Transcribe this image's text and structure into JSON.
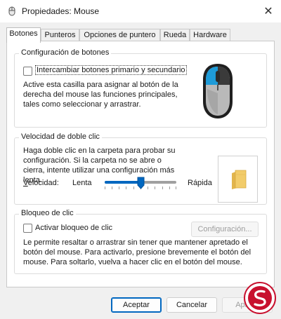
{
  "window": {
    "title": "Propiedades: Mouse",
    "close_glyph": "✕"
  },
  "tabs": [
    {
      "label": "Botones",
      "active": true
    },
    {
      "label": "Punteros",
      "active": false
    },
    {
      "label": "Opciones de puntero",
      "active": false
    },
    {
      "label": "Rueda",
      "active": false
    },
    {
      "label": "Hardware",
      "active": false
    }
  ],
  "button_config": {
    "title": "Configuración de botones",
    "swap_checkbox": {
      "label": "Intercambiar botones primario y secundario",
      "checked": false
    },
    "description": "Active esta casilla para asignar al botón de la derecha del mouse las funciones principales, tales como seleccionar y arrastrar.",
    "illustration_icon": "mouse-icon"
  },
  "double_click": {
    "title": "Velocidad de doble clic",
    "description": "Haga doble clic en la carpeta para probar su configuración. Si la carpeta no se abre o cierra, intente utilizar una configuración más lenta.",
    "speed_label": "Velocidad:",
    "slow_label": "Lenta",
    "fast_label": "Rápida",
    "slider_value_fraction": 0.5,
    "test_icon": "folder-icon"
  },
  "click_lock": {
    "title": "Bloqueo de clic",
    "checkbox": {
      "label": "Activar bloqueo de clic",
      "checked": false
    },
    "settings_button": "Configuración...",
    "description": "Le permite resaltar o arrastrar sin tener que mantener apretado el botón del mouse. Para activarlo, presione brevemente el botón del mouse. Para soltarlo, vuelva a hacer clic en el botón del mouse."
  },
  "footer": {
    "accept": "Aceptar",
    "cancel": "Cancelar",
    "apply": "Aplicar"
  },
  "colors": {
    "accent": "#0067c0",
    "folder": "#f2cc6a"
  },
  "watermark_icon": "solvetic-logo-icon"
}
